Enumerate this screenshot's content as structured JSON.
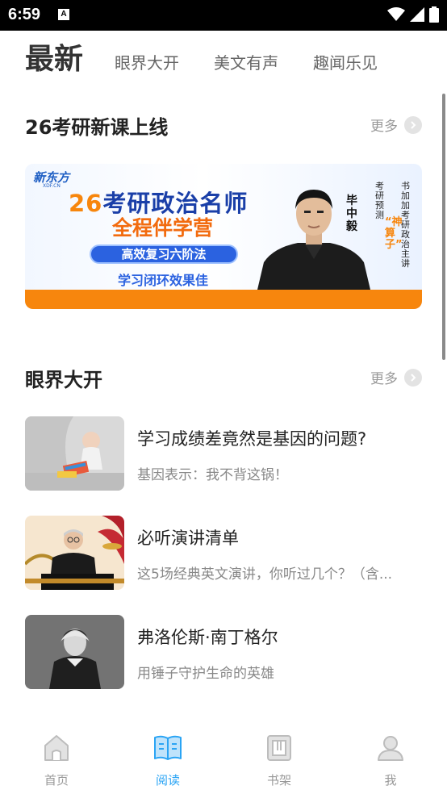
{
  "status_bar": {
    "time": "6:59",
    "notification_icon": "A"
  },
  "top_tabs": [
    {
      "label": "最新",
      "active": true
    },
    {
      "label": "眼界大开",
      "active": false
    },
    {
      "label": "美文有声",
      "active": false
    },
    {
      "label": "趣闻乐见",
      "active": false
    }
  ],
  "section_course": {
    "title": "26考研新课上线",
    "more_label": "更多"
  },
  "banner": {
    "logo": "新东方",
    "logo_sub": "XDF.CN",
    "headline_num": "26",
    "headline_rest": "考研政治名师",
    "subhead": "全程伴学营",
    "pill": "高效复习六阶法",
    "tagline": "学习闭环效果佳",
    "teacher_name": "毕中毅",
    "title_col_1": "考研预测",
    "title_col_2": "书加加考研政治主讲",
    "nickname": "“神算子”",
    "bar_color": "#f7860d"
  },
  "section_eye": {
    "title": "眼界大开",
    "more_label": "更多"
  },
  "articles": [
    {
      "title": "学习成绩差竟然是基因的问题?",
      "desc": "基因表示：我不背这锅！"
    },
    {
      "title": "必听演讲清单",
      "desc": "这5场经典英文演讲，你听过几个？（含..."
    },
    {
      "title": "弗洛伦斯·南丁格尔",
      "desc": "用锤子守护生命的英雄"
    }
  ],
  "bottom_nav": [
    {
      "label": "首页",
      "icon": "home-icon",
      "active": false
    },
    {
      "label": "阅读",
      "icon": "book-open-icon",
      "active": true
    },
    {
      "label": "书架",
      "icon": "bookshelf-icon",
      "active": false
    },
    {
      "label": "我",
      "icon": "user-icon",
      "active": false
    }
  ],
  "colors": {
    "accent": "#2aa4f4",
    "banner_orange": "#f7860d",
    "banner_blue": "#2b62e0"
  }
}
